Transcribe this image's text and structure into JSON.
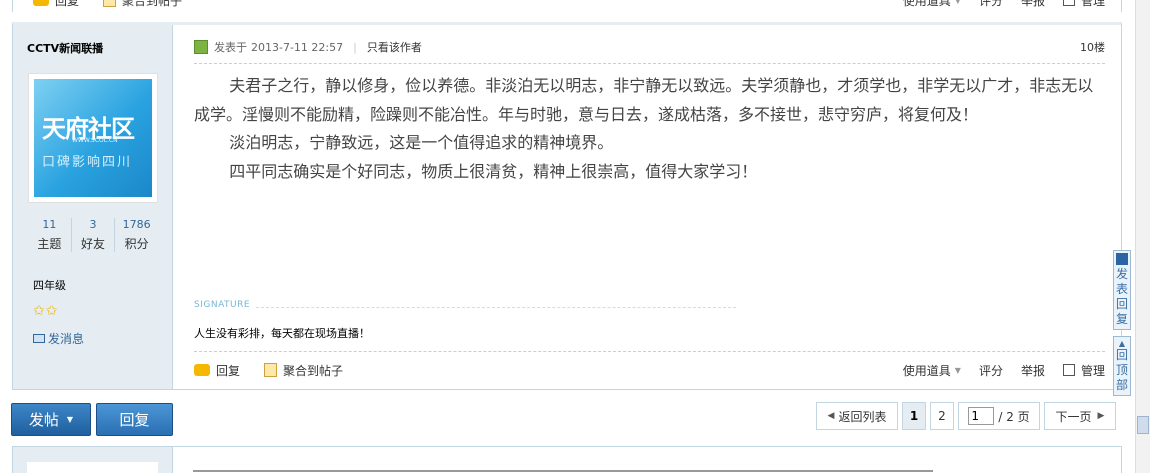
{
  "top_actions": {
    "reply": "回复",
    "collect": "聚合到帖子",
    "tools": "使用道具",
    "rate": "评分",
    "report": "举报",
    "manage": "管理"
  },
  "author": {
    "name": "CCTV新闻联播",
    "avatar": {
      "logo": "天府社区",
      "url": "WWW.SCOL.CN",
      "slogan": "口碑影响四川"
    },
    "stats": [
      {
        "value": "11",
        "label": "主题"
      },
      {
        "value": "3",
        "label": "好友"
      },
      {
        "value": "1786",
        "label": "积分"
      }
    ],
    "level": "四年级",
    "stars": "✩✩",
    "message": "发消息"
  },
  "post": {
    "posted_prefix": "发表于",
    "posted_at": "2013-7-11 22:57",
    "only_author": "只看该作者",
    "floor": "10楼",
    "paragraphs": [
      "夫君子之行，静以修身，俭以养德。非淡泊无以明志，非宁静无以致远。夫学须静也，才须学也，非学无以广才，非志无以成学。淫慢则不能励精，险躁则不能冶性。年与时驰，意与日去，遂成枯落，多不接世，悲守穷庐，将复何及！",
      "淡泊明志，宁静致远，这是一个值得追求的精神境界。",
      "四平同志确实是个好同志，物质上很清贫，精神上很崇高，值得大家学习！"
    ],
    "signature_label": "SIGNATURE",
    "signature": "人生没有彩排，每天都在现场直播！"
  },
  "actions": {
    "reply": "回复",
    "collect": "聚合到帖子",
    "tools": "使用道具",
    "rate": "评分",
    "report": "举报",
    "manage": "管理"
  },
  "buttons": {
    "post": "发帖",
    "reply": "回复"
  },
  "pager": {
    "back": "返回列表",
    "pages": [
      "1",
      "2"
    ],
    "current": "1",
    "input_value": "1",
    "total": "/ 2 页",
    "next": "下一页"
  },
  "side_float": {
    "reply": "发表回复",
    "top": "回顶部"
  },
  "colors": {
    "accent": "#2a6fb2",
    "sidebar_bg": "#e5edf2",
    "border": "#c2d5e3"
  }
}
